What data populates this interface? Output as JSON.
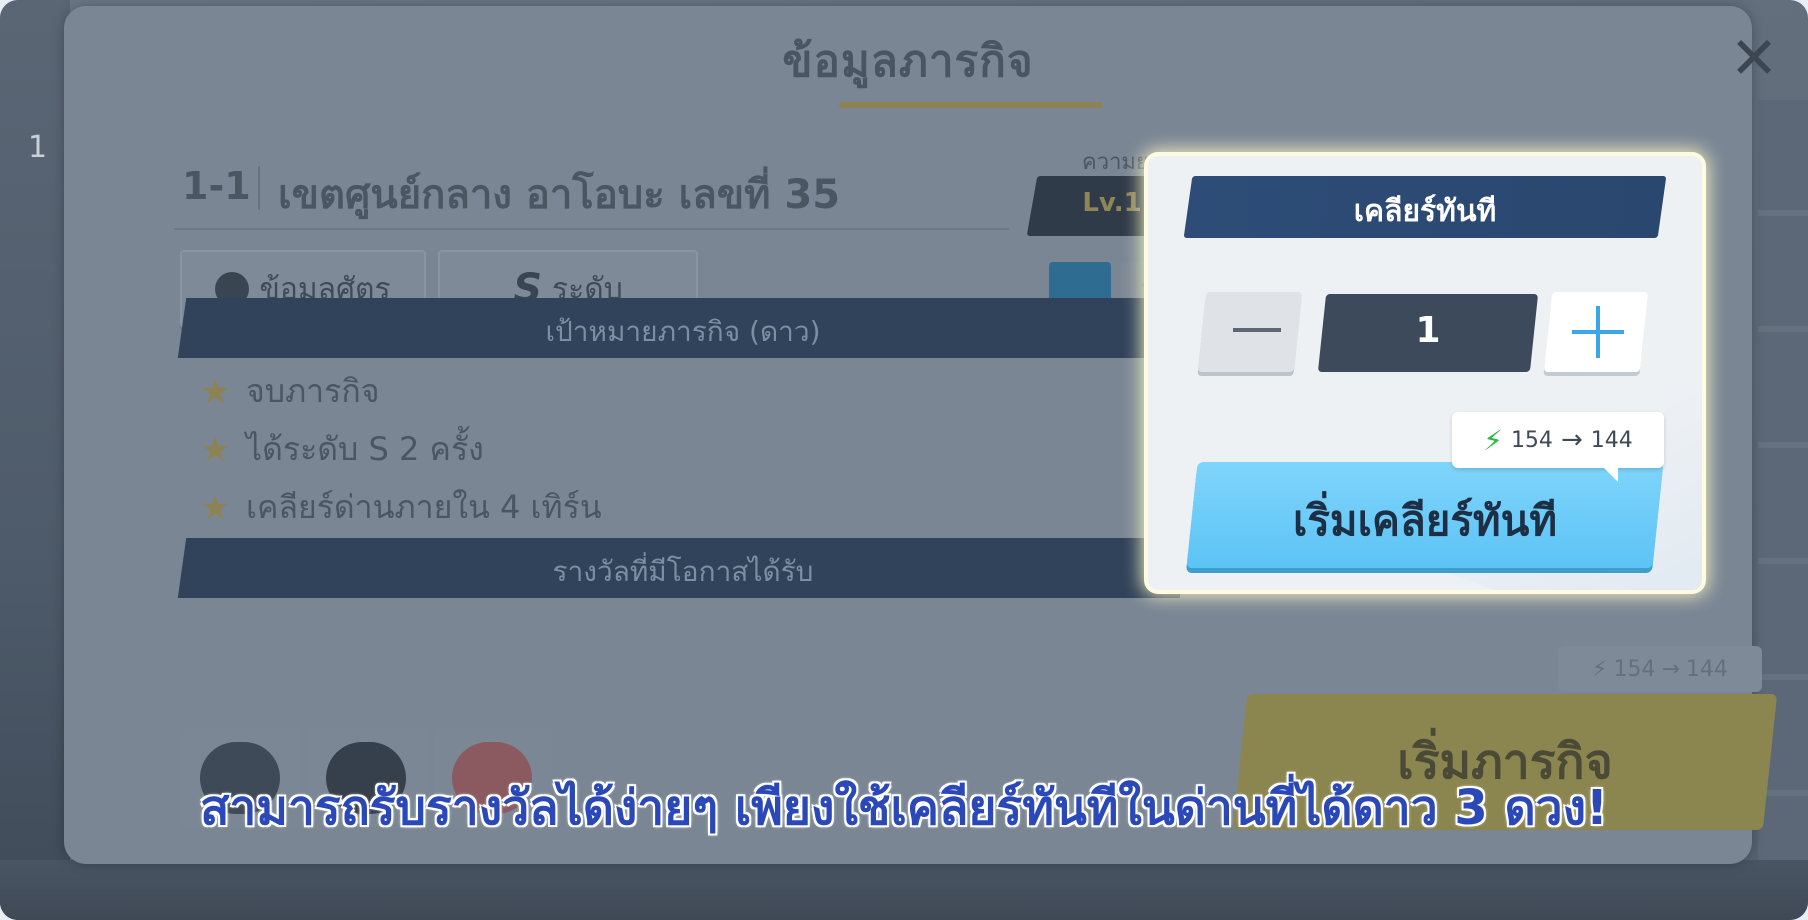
{
  "dialog": {
    "title": "ข้อมูลภารกิจ",
    "close_label": "✕",
    "stage": {
      "number": "1-1",
      "name": "เขตศูนย์กลาง อาโอบะ เลขที่ 35",
      "difficulty_caption": "ความยาก",
      "level": "Lv.1"
    },
    "tabs": {
      "enemy_info": "ข้อมูลศัตรู",
      "rank_letter": "S",
      "rank_label": "ระดับ"
    },
    "goals_header": "เป้าหมายภารกิจ (ดาว)",
    "goals": [
      "จบภารกิจ",
      "ได้ระดับ S 2 ครั้ง",
      "เคลียร์ด่านภายใน 4 เทิร์น"
    ],
    "rewards_header": "รางวัลที่มีโอกาสได้รับ",
    "rewards": [
      "cap-icon",
      "gloves-icon",
      "shoes-icon"
    ],
    "energy_from": "154",
    "energy_to": "144",
    "start_mission_label": "เริ่มภารกิจ"
  },
  "popup": {
    "title": "เคลียร์ทันที",
    "minus_label": "—",
    "quantity": "1",
    "plus_label": "+",
    "energy_from": "154",
    "energy_to": "144",
    "start_label": "เริ่มเคลียร์ทันที"
  },
  "subtitle": "สามารถรับรางวัลได้ง่ายๆ เพียงใช้เคลียร์ทันทีในด่านที่ได้ดาว 3 ดวง!",
  "background": {
    "left_number": "1"
  },
  "colors": {
    "popup_header": "#2d4c77",
    "start_clear_button": "#5cc3f5",
    "plus_accent": "#3ba7e6",
    "energy_bolt": "#2db84a",
    "subtitle_text": "#2b48b8",
    "highlight_glow": "#fffbe0"
  }
}
